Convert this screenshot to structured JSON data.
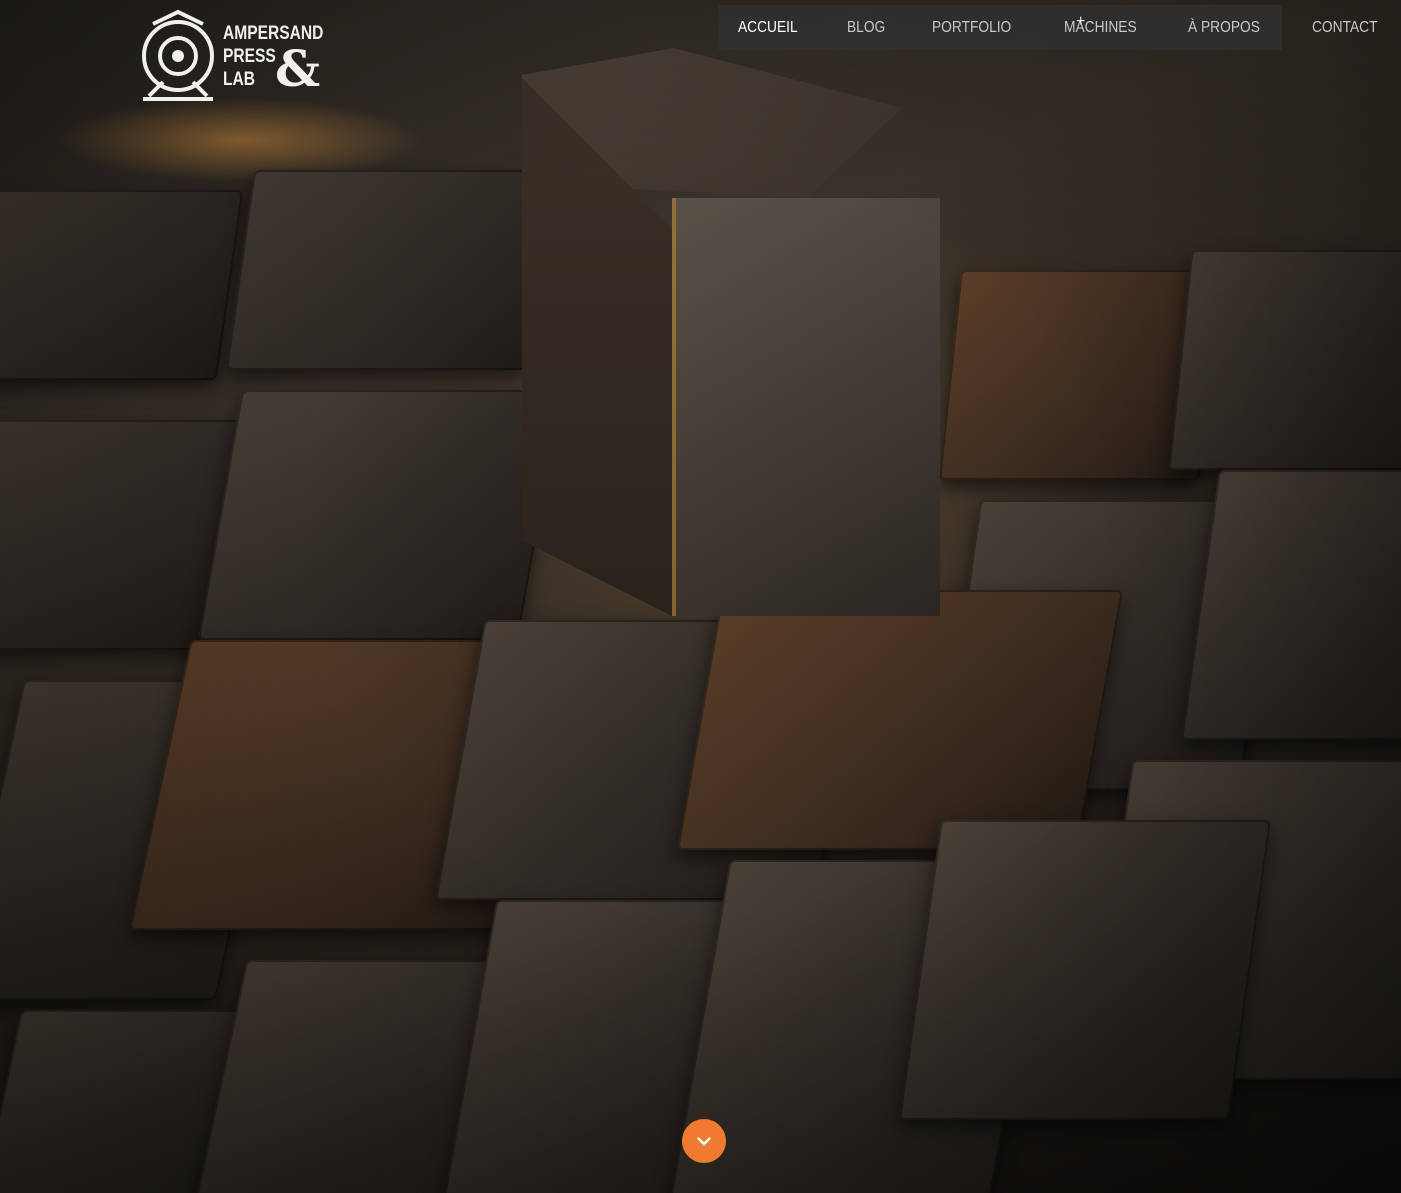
{
  "site": {
    "logo": {
      "line1": "AMPERSAND",
      "line2": "PRESS",
      "line3": "LAB",
      "ampersand": "&"
    }
  },
  "nav": {
    "items": [
      {
        "label": "ACCUEIL",
        "active": true
      },
      {
        "label": "BLOG",
        "active": false
      },
      {
        "label": "PORTFOLIO",
        "active": false
      },
      {
        "label": "MACHINES",
        "active": false,
        "has_submenu": true
      },
      {
        "label": "À PROPOS",
        "active": false
      },
      {
        "label": "CONTACT",
        "active": false
      }
    ],
    "submenu_indicator": "+"
  },
  "hero": {
    "image_icon": "wood-type-blocks-photo",
    "scroll_icon": "chevron-down-icon"
  },
  "colors": {
    "accent": "#f07b2e",
    "nav_bg": "#303030",
    "nav_text": "#c9c9c9",
    "nav_active_text": "#ffffff"
  }
}
